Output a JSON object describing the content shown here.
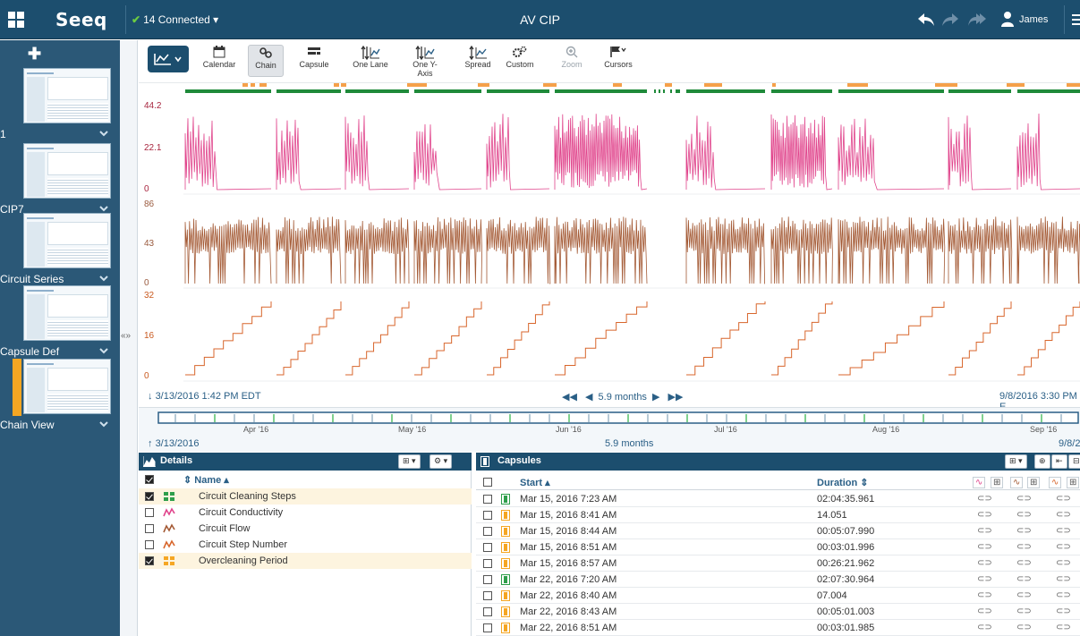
{
  "app": {
    "logo": "Seeq",
    "connection": "14 Connected",
    "title": "AV CIP",
    "user": "James"
  },
  "sidebar": {
    "worksheets": [
      {
        "label": "1",
        "active": false
      },
      {
        "label": "CIP7",
        "active": false
      },
      {
        "label": "Circuit Series",
        "active": false
      },
      {
        "label": "Capsule Def",
        "active": false
      },
      {
        "label": "Chain View",
        "active": true
      }
    ]
  },
  "toolbar": {
    "buttons": [
      {
        "label": "Calendar",
        "icon": "calendar-icon",
        "selected": false,
        "disabled": false
      },
      {
        "label": "Chain",
        "icon": "chain-icon",
        "selected": true,
        "disabled": false
      },
      {
        "label": "Capsule",
        "icon": "capsule-icon",
        "selected": false,
        "disabled": false
      },
      {
        "label": "One Lane",
        "icon": "one-lane-icon",
        "selected": false,
        "disabled": false
      },
      {
        "label": "One Y-Axis",
        "icon": "one-y-axis-icon",
        "selected": false,
        "disabled": false
      },
      {
        "label": "Spread",
        "icon": "spread-icon",
        "selected": false,
        "disabled": false
      },
      {
        "label": "Custom",
        "icon": "custom-icon",
        "selected": false,
        "disabled": false
      },
      {
        "label": "Zoom",
        "icon": "zoom-icon",
        "selected": false,
        "disabled": true
      },
      {
        "label": "Cursors",
        "icon": "cursors-icon",
        "selected": false,
        "disabled": false
      }
    ]
  },
  "trend": {
    "lanes": [
      {
        "name": "Circuit Conductivity",
        "color": "#e0438b",
        "ticks": [
          "44.2",
          "22.1",
          "0"
        ]
      },
      {
        "name": "Circuit Flow",
        "color": "#a45a35",
        "ticks": [
          "86",
          "43",
          "0"
        ]
      },
      {
        "name": "Circuit Step Number",
        "color": "#d8662c",
        "ticks": [
          "32",
          "16",
          "0"
        ]
      }
    ],
    "start_time": "3/13/2016 1:42 PM EDT",
    "duration": "5.9 months",
    "end_time": "9/8/2016 3:30 PM E"
  },
  "overview": {
    "months": [
      "Apr '16",
      "May '16",
      "Jun '16",
      "Jul '16",
      "Aug '16",
      "Sep '16"
    ],
    "start": "3/13/2016",
    "duration": "5.9 months",
    "end": "9/8/2"
  },
  "details": {
    "title": "Details",
    "column": "Name",
    "items": [
      {
        "name": "Circuit Cleaning Steps",
        "checked": true,
        "type": "condition",
        "color": "#2e9e4a",
        "highlight": true
      },
      {
        "name": "Circuit Conductivity",
        "checked": false,
        "type": "signal",
        "color": "#e0438b",
        "highlight": false
      },
      {
        "name": "Circuit Flow",
        "checked": false,
        "type": "signal",
        "color": "#a45a35",
        "highlight": false
      },
      {
        "name": "Circuit Step Number",
        "checked": false,
        "type": "signal",
        "color": "#d8662c",
        "highlight": false
      },
      {
        "name": "Overcleaning Period",
        "checked": true,
        "type": "condition",
        "color": "#f5a623",
        "highlight": true
      }
    ]
  },
  "capsules": {
    "title": "Capsules",
    "col_start": "Start",
    "col_duration": "Duration",
    "rows": [
      {
        "start": "Mar 15, 2016 7:23 AM",
        "duration": "02:04:35.961",
        "color": "#2e9e4a"
      },
      {
        "start": "Mar 15, 2016 8:41 AM",
        "duration": "14.051",
        "color": "#f5a623"
      },
      {
        "start": "Mar 15, 2016 8:44 AM",
        "duration": "00:05:07.990",
        "color": "#f5a623"
      },
      {
        "start": "Mar 15, 2016 8:51 AM",
        "duration": "00:03:01.996",
        "color": "#f5a623"
      },
      {
        "start": "Mar 15, 2016 8:57 AM",
        "duration": "00:26:21.962",
        "color": "#f5a623"
      },
      {
        "start": "Mar 22, 2016 7:20 AM",
        "duration": "02:07:30.964",
        "color": "#2e9e4a"
      },
      {
        "start": "Mar 22, 2016 8:40 AM",
        "duration": "07.004",
        "color": "#f5a623"
      },
      {
        "start": "Mar 22, 2016 8:43 AM",
        "duration": "00:05:01.003",
        "color": "#f5a623"
      },
      {
        "start": "Mar 22, 2016 8:51 AM",
        "duration": "00:03:01.985",
        "color": "#f5a623"
      }
    ]
  }
}
